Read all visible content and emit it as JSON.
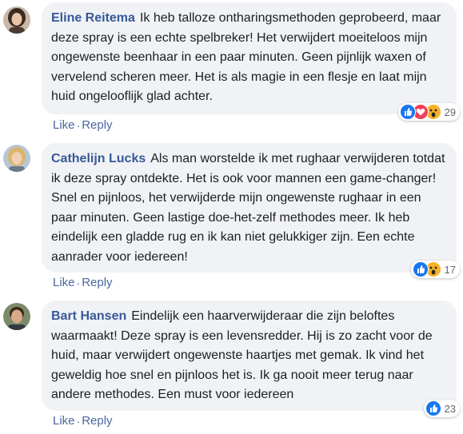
{
  "comments": [
    {
      "author": "Eline Reitema",
      "text": "Ik heb talloze ontharingsmethoden geprobeerd, maar deze spray is een echte spelbreker! Het verwijdert moeiteloos mijn ongewenste beenhaar in een paar minuten. Geen pijnlijk waxen of vervelend scheren meer. Het is als magie in een flesje en laat mijn huid ongelooflijk glad achter.",
      "reactions": [
        "like-icon",
        "love-icon",
        "wow-icon"
      ],
      "reaction_count": "29",
      "like_label": "Like",
      "separator": "·",
      "reply_label": "Reply"
    },
    {
      "author": "Cathelijn Lucks",
      "text": "Als man worstelde ik met rughaar verwijderen totdat ik deze spray ontdekte. Het is ook voor mannen een game-changer! Snel en pijnloos, het verwijderde mijn ongewenste rughaar in een paar minuten. Geen lastige doe-het-zelf methodes meer. Ik heb eindelijk een gladde rug en ik kan niet gelukkiger zijn. Een echte aanrader voor iedereen!",
      "reactions": [
        "like-icon",
        "wow-icon"
      ],
      "reaction_count": "17",
      "like_label": "Like",
      "separator": "·",
      "reply_label": "Reply"
    },
    {
      "author": "Bart Hansen",
      "text": "Eindelijk een haarverwijderaar die zijn beloftes waarmaakt! Deze spray is een levensredder. Hij is zo zacht voor de huid, maar verwijdert ongewenste haartjes met gemak. Ik vind het geweldig hoe snel en pijnloos het is. Ik ga nooit meer terug naar andere methodes. Een must voor iedereen",
      "reactions": [
        "like-icon"
      ],
      "reaction_count": "23",
      "like_label": "Like",
      "separator": "·",
      "reply_label": "Reply"
    }
  ],
  "colors": {
    "author": "#385898",
    "bubble": "#f0f2f5",
    "like": "#1877f2",
    "love": "#f33e58",
    "wow": "#f7b125"
  }
}
